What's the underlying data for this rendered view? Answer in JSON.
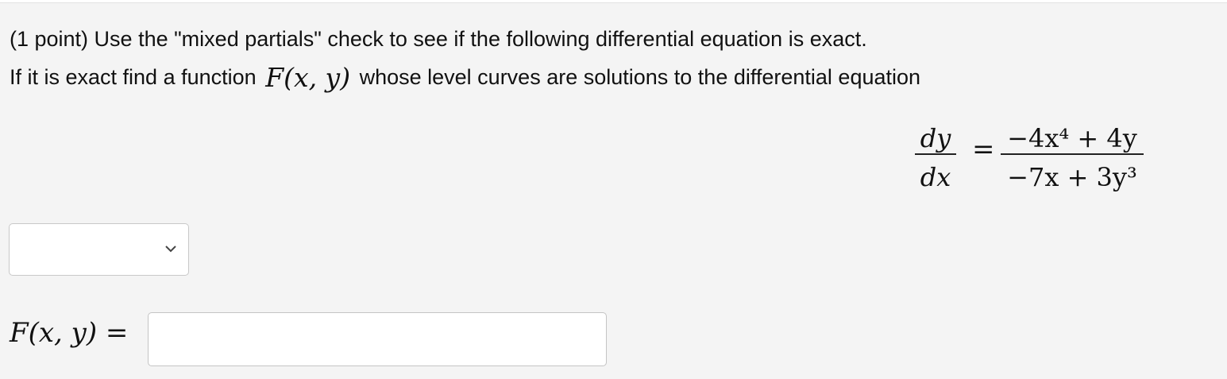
{
  "problem": {
    "line1": "(1 point) Use the \"mixed partials\" check to see if the following differential equation is exact.",
    "line2_before": "If it is exact find a function",
    "line2_after": "whose level curves are solutions to the differential equation",
    "function_notation": "F(x, y)"
  },
  "equation": {
    "lhs_numerator": "dy",
    "lhs_denominator": "dx",
    "equals": "=",
    "rhs_numerator": "−4x⁴ + 4y",
    "rhs_denominator": "−7x + 3y³"
  },
  "exact_select": {
    "selected_value": "",
    "icon": "chevron-down-icon"
  },
  "answer": {
    "label": "F(x, y) =",
    "value": "",
    "placeholder": ""
  }
}
